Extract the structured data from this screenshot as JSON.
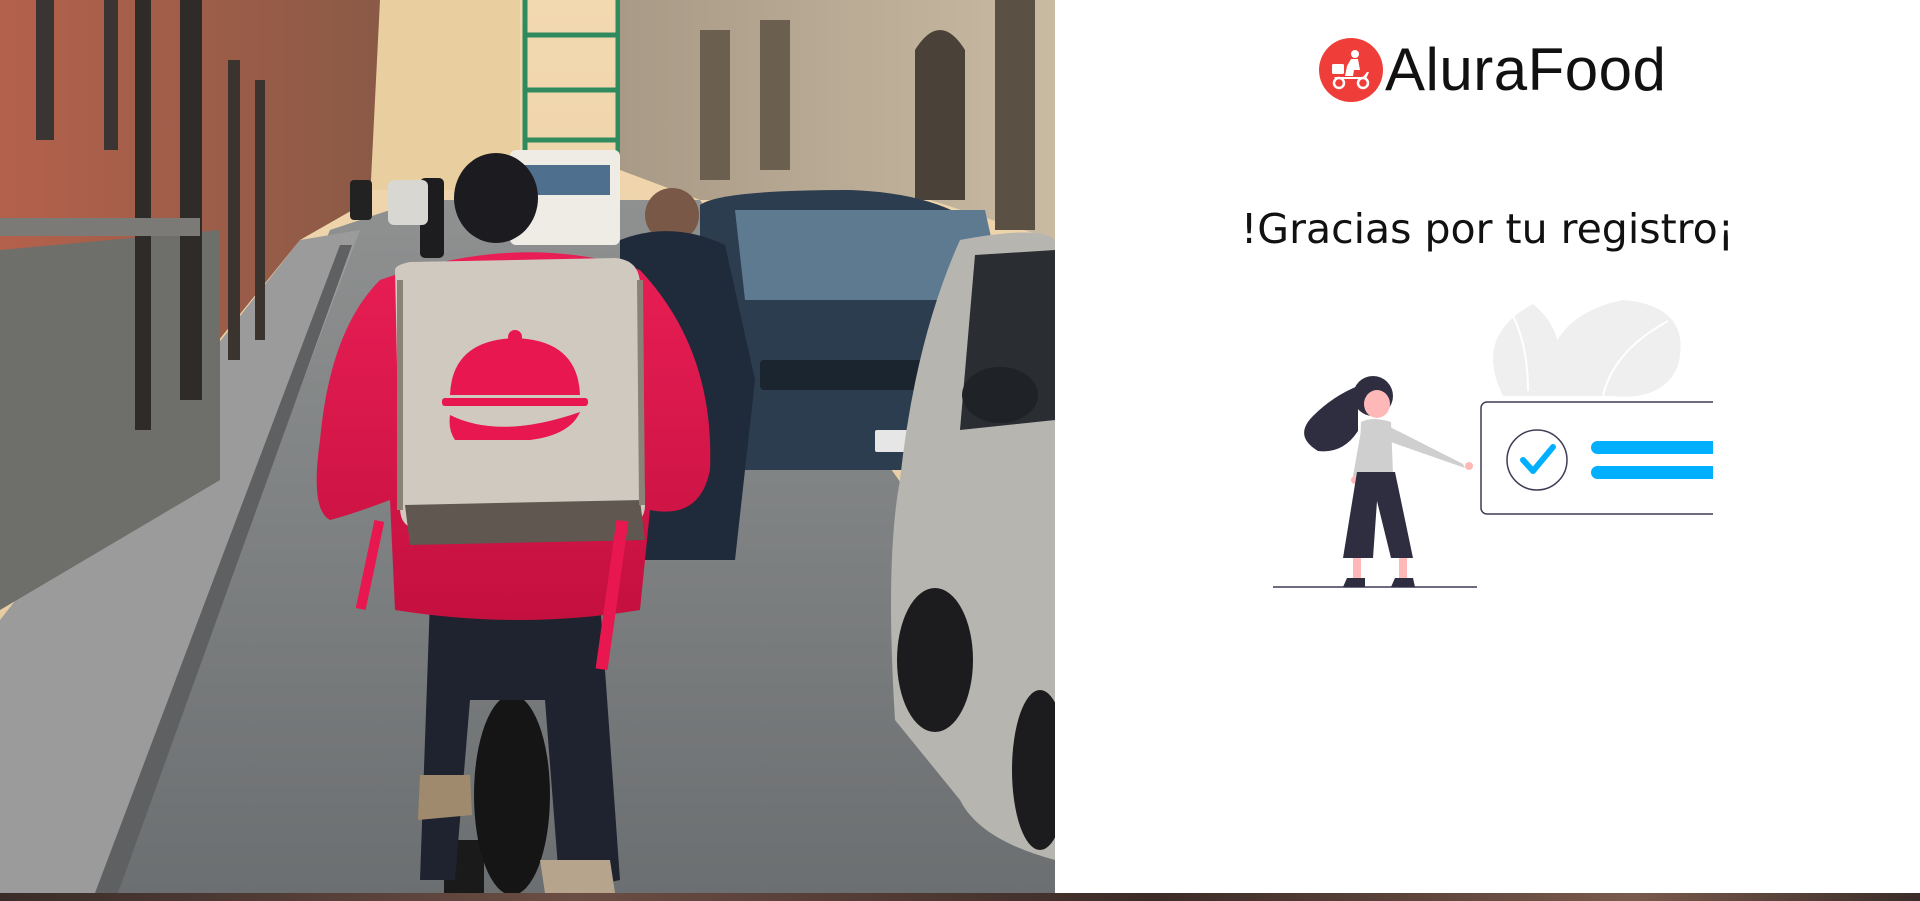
{
  "brand": {
    "name": "AluraFood",
    "logo_icon": "delivery-scooter-icon",
    "logo_color": "#ef3e3a"
  },
  "confirmation": {
    "message": "!Gracias por tu registro¡",
    "illustration_icon": "registration-success-illustration",
    "accent_color": "#00b0ff"
  },
  "hero_image": {
    "icon": "delivery-cyclist-photo",
    "backpack_color": "#e8174f"
  }
}
